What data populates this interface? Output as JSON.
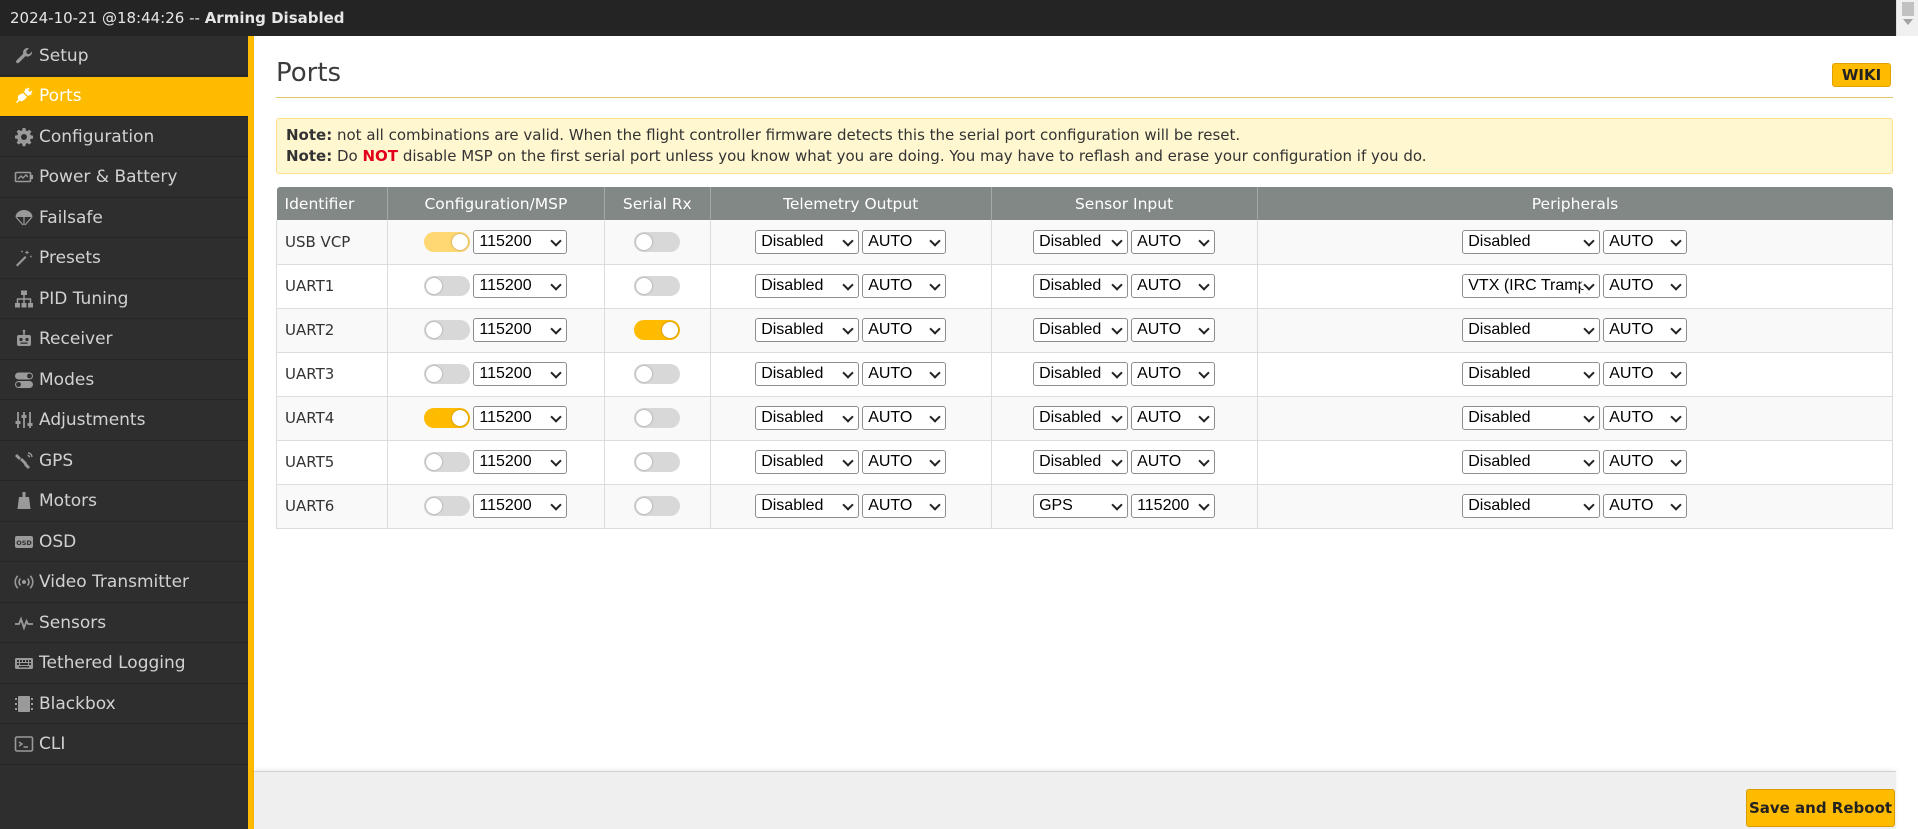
{
  "titlebar": {
    "timestamp": "2024-10-21 @18:44:26 --",
    "status": "Arming Disabled"
  },
  "sidebar": {
    "active_index": 1,
    "items": [
      {
        "label": "Setup",
        "icon": "wrench-icon"
      },
      {
        "label": "Ports",
        "icon": "plug-icon"
      },
      {
        "label": "Configuration",
        "icon": "gear-icon"
      },
      {
        "label": "Power & Battery",
        "icon": "battery-icon"
      },
      {
        "label": "Failsafe",
        "icon": "parachute-icon"
      },
      {
        "label": "Presets",
        "icon": "wand-icon"
      },
      {
        "label": "PID Tuning",
        "icon": "sitemap-icon"
      },
      {
        "label": "Receiver",
        "icon": "robot-icon"
      },
      {
        "label": "Modes",
        "icon": "toggles-icon"
      },
      {
        "label": "Adjustments",
        "icon": "sliders-icon"
      },
      {
        "label": "GPS",
        "icon": "satellite-icon"
      },
      {
        "label": "Motors",
        "icon": "motor-icon"
      },
      {
        "label": "OSD",
        "icon": "osd-icon"
      },
      {
        "label": "Video Transmitter",
        "icon": "broadcast-icon"
      },
      {
        "label": "Sensors",
        "icon": "pulse-icon"
      },
      {
        "label": "Tethered Logging",
        "icon": "keyboard-icon"
      },
      {
        "label": "Blackbox",
        "icon": "blackbox-icon"
      },
      {
        "label": "CLI",
        "icon": "terminal-icon"
      }
    ]
  },
  "page": {
    "title": "Ports",
    "wiki_label": "WIKI"
  },
  "note": {
    "label": "Note:",
    "line1": "not all combinations are valid. When the flight controller firmware detects this the serial port configuration will be reset.",
    "line2_prefix": "Do",
    "line2_not": "NOT",
    "line2_suffix": "disable MSP on the first serial port unless you know what you are doing. You may have to reflash and erase your configuration if you do."
  },
  "table": {
    "headers": [
      "Identifier",
      "Configuration/MSP",
      "Serial Rx",
      "Telemetry Output",
      "Sensor Input",
      "Peripherals"
    ],
    "rows": [
      {
        "id": "USB VCP",
        "msp": true,
        "msp_disabled": true,
        "msp_baud": "115200",
        "serial_rx": false,
        "telemetry": "Disabled",
        "telemetry_baud": "AUTO",
        "sensor": "Disabled",
        "sensor_baud": "AUTO",
        "peripheral": "Disabled",
        "peripheral_baud": "AUTO"
      },
      {
        "id": "UART1",
        "msp": false,
        "msp_disabled": false,
        "msp_baud": "115200",
        "serial_rx": false,
        "telemetry": "Disabled",
        "telemetry_baud": "AUTO",
        "sensor": "Disabled",
        "sensor_baud": "AUTO",
        "peripheral": "VTX (IRC Tramp)",
        "peripheral_baud": "AUTO"
      },
      {
        "id": "UART2",
        "msp": false,
        "msp_disabled": false,
        "msp_baud": "115200",
        "serial_rx": true,
        "telemetry": "Disabled",
        "telemetry_baud": "AUTO",
        "sensor": "Disabled",
        "sensor_baud": "AUTO",
        "peripheral": "Disabled",
        "peripheral_baud": "AUTO"
      },
      {
        "id": "UART3",
        "msp": false,
        "msp_disabled": false,
        "msp_baud": "115200",
        "serial_rx": false,
        "telemetry": "Disabled",
        "telemetry_baud": "AUTO",
        "sensor": "Disabled",
        "sensor_baud": "AUTO",
        "peripheral": "Disabled",
        "peripheral_baud": "AUTO"
      },
      {
        "id": "UART4",
        "msp": true,
        "msp_disabled": false,
        "msp_baud": "115200",
        "serial_rx": false,
        "telemetry": "Disabled",
        "telemetry_baud": "AUTO",
        "sensor": "Disabled",
        "sensor_baud": "AUTO",
        "peripheral": "Disabled",
        "peripheral_baud": "AUTO"
      },
      {
        "id": "UART5",
        "msp": false,
        "msp_disabled": false,
        "msp_baud": "115200",
        "serial_rx": false,
        "telemetry": "Disabled",
        "telemetry_baud": "AUTO",
        "sensor": "Disabled",
        "sensor_baud": "AUTO",
        "peripheral": "Disabled",
        "peripheral_baud": "AUTO"
      },
      {
        "id": "UART6",
        "msp": false,
        "msp_disabled": false,
        "msp_baud": "115200",
        "serial_rx": false,
        "telemetry": "Disabled",
        "telemetry_baud": "AUTO",
        "sensor": "GPS",
        "sensor_baud": "115200",
        "peripheral": "Disabled",
        "peripheral_baud": "AUTO"
      }
    ]
  },
  "footer": {
    "save_label": "Save and Reboot"
  },
  "colors": {
    "accent": "#ffbb00",
    "sidebar_bg": "#2e2e2e",
    "titlebar_bg": "#242424",
    "note_bg": "#fff7d0",
    "table_header_bg": "#828885",
    "warning_red": "#e2001a"
  }
}
